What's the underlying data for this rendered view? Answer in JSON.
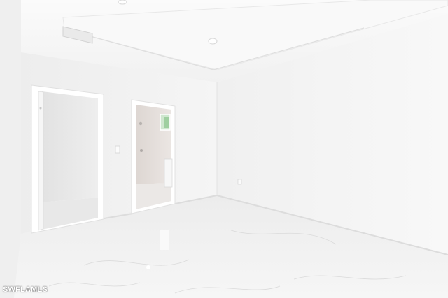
{
  "photo": {
    "subject": "empty-bedroom-interior",
    "watermark": "SWFLAMLS"
  },
  "palette": {
    "wall": "#f3f3f3",
    "wall_shadow": "#e6e6e6",
    "ceiling": "#f7f7f7",
    "floor": "#eaeaea",
    "trim": "#ffffff",
    "door_opening": "#e9e9e9",
    "bathroom": "#e3dcd8",
    "window": "#bfe3f0"
  }
}
